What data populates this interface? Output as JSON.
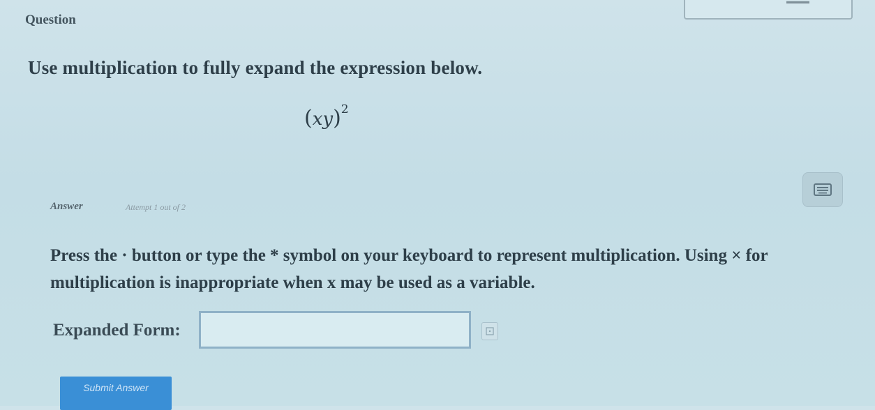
{
  "header": {
    "question_label": "Question"
  },
  "question": {
    "instruction": "Use multiplication to fully expand the expression below.",
    "expression": {
      "open": "(",
      "variables": "xy",
      "close": ")",
      "exponent": "2"
    }
  },
  "answer": {
    "label": "Answer",
    "attempt": "Attempt 1 out of 2",
    "help_text": "Press the · button or type the * symbol on your keyboard to represent multiplication. Using × for multiplication is inappropriate when x may be used as a variable.",
    "expanded_label": "Expanded Form:",
    "input_value": "",
    "input_placeholder": ""
  },
  "buttons": {
    "submit_label": "Submit Answer"
  },
  "icons": {
    "keyboard": "keyboard-icon",
    "math_helper": "math-symbol-icon"
  },
  "colors": {
    "background": "#c4dde6",
    "submit_button": "#3a8fd6",
    "input_border": "#8fb1c7",
    "keyboard_button": "#b7cfd8"
  }
}
